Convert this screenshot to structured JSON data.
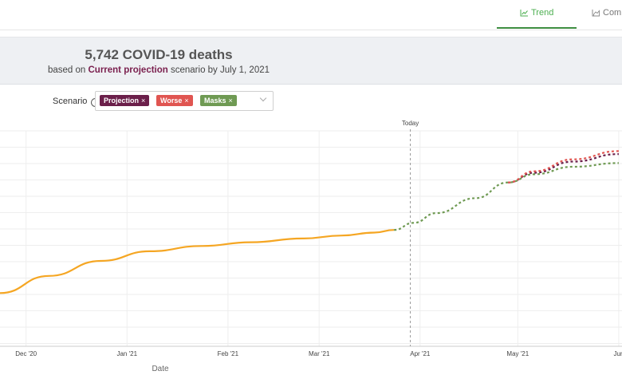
{
  "tabs": [
    {
      "label": "Trend",
      "icon": "line-chart-icon",
      "active": true
    },
    {
      "label": "Com",
      "icon": "area-chart-icon",
      "active": false
    }
  ],
  "summary": {
    "count": "5,742",
    "title_rest": "COVID-19 deaths",
    "sub_prefix": "based on",
    "scenario": "Current projection",
    "sub_suffix": "scenario by July 1, 2021"
  },
  "scenario_select": {
    "label": "Scenario",
    "info_icon": "info-icon",
    "chips": [
      {
        "label": "Projection",
        "color": "#6b1f4a"
      },
      {
        "label": "Worse",
        "color": "#e05551"
      },
      {
        "label": "Masks",
        "color": "#6f9a53"
      }
    ],
    "remove_glyph": "×"
  },
  "chart_data": {
    "type": "line",
    "xlabel": "Date",
    "today_label": "Today",
    "today": "2021-03-29",
    "x_ticks": [
      "Dec '20",
      "Jan '21",
      "Feb '21",
      "Mar '21",
      "Apr '21",
      "May '21",
      "Jun"
    ],
    "y_visible": false,
    "grid": true,
    "series": [
      {
        "style": "solid",
        "color": "#f5a623",
        "points": [
          [
            "2020-11-23",
            4000
          ],
          [
            "2020-12-08",
            4230
          ],
          [
            "2020-12-24",
            4430
          ],
          [
            "2021-01-08",
            4560
          ],
          [
            "2021-01-24",
            4630
          ],
          [
            "2021-02-08",
            4680
          ],
          [
            "2021-02-24",
            4730
          ],
          [
            "2021-03-08",
            4770
          ],
          [
            "2021-03-18",
            4810
          ],
          [
            "2021-03-24",
            4845
          ]
        ]
      },
      {
        "style": "dashed",
        "color": "#6f9a53",
        "points": [
          [
            "2021-03-24",
            4845
          ],
          [
            "2021-03-30",
            4940
          ],
          [
            "2021-04-06",
            5070
          ],
          [
            "2021-04-18",
            5270
          ],
          [
            "2021-04-28",
            5480
          ],
          [
            "2021-05-06",
            5590
          ],
          [
            "2021-05-18",
            5690
          ],
          [
            "2021-06-01",
            5740
          ]
        ]
      },
      {
        "style": "dashed",
        "color": "#6b1f4a",
        "points": [
          [
            "2021-04-28",
            5480
          ],
          [
            "2021-05-06",
            5610
          ],
          [
            "2021-05-18",
            5760
          ],
          [
            "2021-06-01",
            5860
          ]
        ]
      },
      {
        "style": "dashed",
        "color": "#e05551",
        "points": [
          [
            "2021-04-28",
            5480
          ],
          [
            "2021-05-06",
            5630
          ],
          [
            "2021-05-18",
            5790
          ],
          [
            "2021-06-01",
            5900
          ]
        ]
      }
    ]
  }
}
